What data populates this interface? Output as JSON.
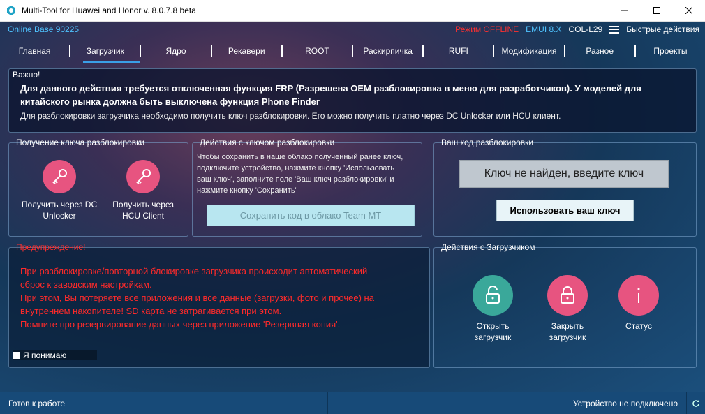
{
  "window": {
    "title": "Multi-Tool for Huawei and Honor v. 8.0.7.8 beta",
    "minimize_icon": "minimize-icon",
    "maximize_icon": "maximize-icon",
    "close_icon": "close-icon"
  },
  "topinfo": {
    "online_base": "Online Base 90225",
    "mode": "Режим OFFLINE",
    "emui": "EMUI 8.X",
    "model": "COL-L29",
    "quick_actions": "Быстрые действия"
  },
  "tabs": [
    {
      "label": "Главная"
    },
    {
      "label": "Загрузчик"
    },
    {
      "label": "Ядро"
    },
    {
      "label": "Рекавери"
    },
    {
      "label": "ROOT"
    },
    {
      "label": "Раскирпичка"
    },
    {
      "label": "RUFI"
    },
    {
      "label": "Модификация"
    },
    {
      "label": "Разное"
    },
    {
      "label": "Проекты"
    }
  ],
  "important": {
    "label": "Важно!",
    "bold_line1": "Для данного действия требуется отключенная функция FRP (Разрешена OEM разблокировка в меню для разработчиков). У моделей для",
    "bold_line2": "китайского рынка должна быть выключена функция Phone Finder",
    "note": "Для разблокировки загрузчика необходимо получить ключ разблокировки. Его можно получить платно через DC Unlocker или HCU клиент."
  },
  "get_key": {
    "title": "Получение ключа разблокировки",
    "dc_label1": "Получить через DC",
    "dc_label2": "Unlocker",
    "hcu_label1": "Получить через",
    "hcu_label2": "HCU Client"
  },
  "key_actions": {
    "title": "Действия с ключом разблокировки",
    "text1": "Чтобы сохранить в наше облако полученный ранее ключ,",
    "text2": "подключите устройство, нажмите кнопку 'Использовать",
    "text3": "ваш ключ', заполните поле 'Ваш ключ разблокировки' и",
    "text4": "нажмите кнопку 'Сохранить'",
    "save_button": "Сохранить код в облако Team MT"
  },
  "unlock_code": {
    "title": "Ваш код разблокировки",
    "key_value": "Ключ не найден, введите ключ",
    "use_button": "Использовать ваш ключ"
  },
  "warning": {
    "title": "Предупреждение!",
    "line1": "При разблокировке/повторной блокировке загрузчика происходит автоматический",
    "line2": "сброс к заводским настройкам.",
    "line3": "При этом, Вы потеряете все приложения и все данные (загрузки, фото и прочее) на",
    "line4": "внутреннем накопителе! SD карта не затрагивается при этом.",
    "line5": "Помните про резервирование данных через приложение 'Резервная копия'.",
    "understand": "Я понимаю"
  },
  "bootloader_actions": {
    "title": "Действия с Загрузчиком",
    "open_label1": "Открыть",
    "open_label2": "загрузчик",
    "close_label1": "Закрыть",
    "close_label2": "загрузчик",
    "status_label": "Статус"
  },
  "status": {
    "left": "Готов к работе",
    "right": "Устройство не подключено"
  },
  "colors": {
    "pink": "#e75480",
    "teal": "#3aa89a",
    "accent": "#3aa0e8",
    "warning": "#ff2a2a"
  }
}
